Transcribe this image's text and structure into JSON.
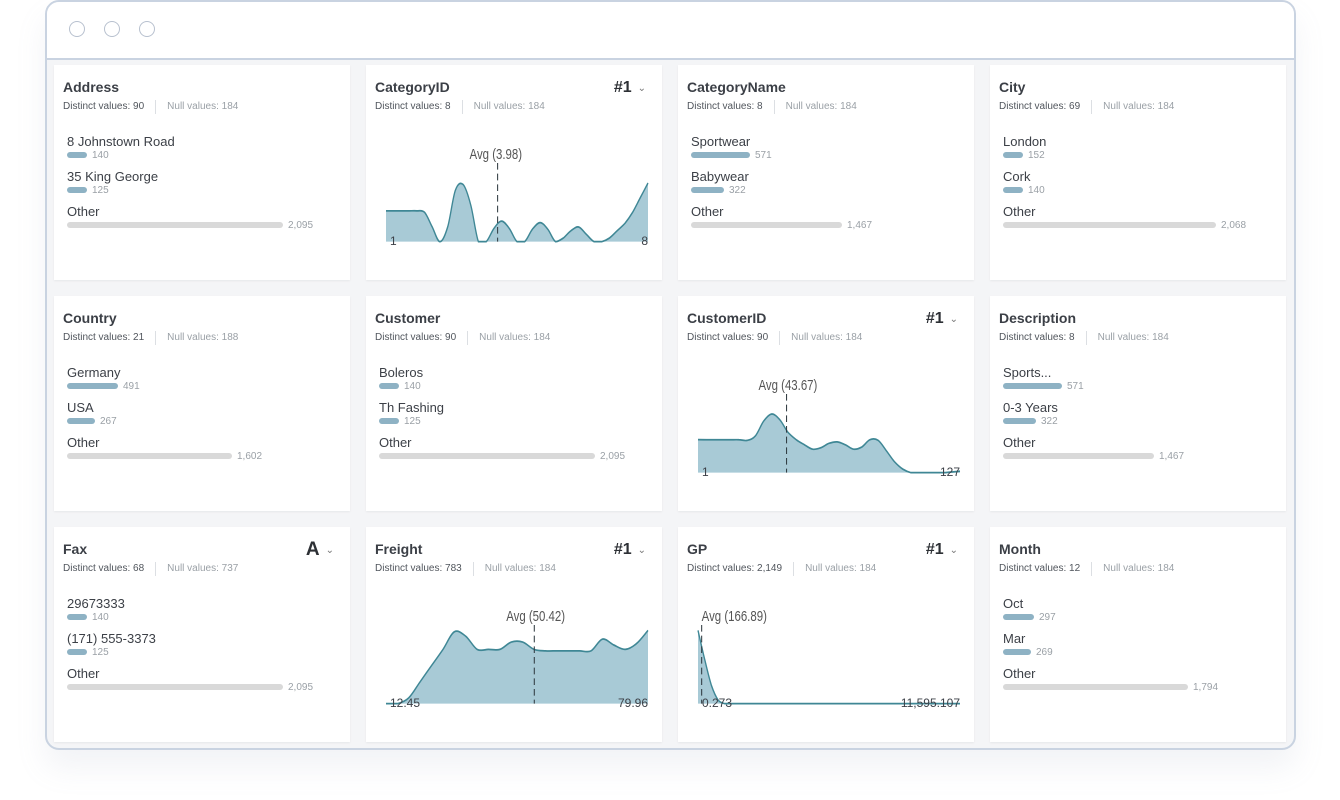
{
  "window": {
    "controls": [
      "close",
      "minimize",
      "maximize"
    ]
  },
  "labels": {
    "distinct_prefix": "Distinct values:",
    "null_prefix": "Null values:"
  },
  "cards": [
    {
      "title": "Address",
      "kind": "text",
      "distinct": "90",
      "nulls": "184",
      "values": [
        {
          "label": "8 Johnstown Road",
          "count": "140",
          "n": 140
        },
        {
          "label": "35 King George",
          "count": "125",
          "n": 125
        },
        {
          "label": "Other",
          "count": "2,095",
          "n": 2095,
          "other": true
        }
      ]
    },
    {
      "title": "CategoryID",
      "kind": "numeric",
      "type_label": "#1",
      "distinct": "8",
      "nulls": "184",
      "min": "1",
      "max": "8",
      "avg_label": "Avg (3.98)",
      "avg_frac": 0.426,
      "density": [
        0.42,
        0.42,
        0.42,
        0.42,
        0.42,
        0.4,
        0.2,
        0.0,
        0.2,
        0.7,
        0.78,
        0.5,
        0.0,
        0.0,
        0.18,
        0.28,
        0.18,
        0.0,
        0.0,
        0.17,
        0.26,
        0.17,
        0.0,
        0.05,
        0.15,
        0.2,
        0.1,
        0.0,
        0.0,
        0.05,
        0.15,
        0.25,
        0.4,
        0.6,
        0.8
      ]
    },
    {
      "title": "CategoryName",
      "kind": "text",
      "distinct": "8",
      "nulls": "184",
      "values": [
        {
          "label": "Sportwear",
          "count": "571",
          "n": 571
        },
        {
          "label": "Babywear",
          "count": "322",
          "n": 322
        },
        {
          "label": "Other",
          "count": "1,467",
          "n": 1467,
          "other": true
        }
      ]
    },
    {
      "title": "City",
      "kind": "text",
      "distinct": "69",
      "nulls": "184",
      "values": [
        {
          "label": "London",
          "count": "152",
          "n": 152
        },
        {
          "label": "Cork",
          "count": "140",
          "n": 140
        },
        {
          "label": "Other",
          "count": "2,068",
          "n": 2068,
          "other": true
        }
      ]
    },
    {
      "title": "Country",
      "kind": "text",
      "distinct": "21",
      "nulls": "188",
      "values": [
        {
          "label": "Germany",
          "count": "491",
          "n": 491
        },
        {
          "label": "USA",
          "count": "267",
          "n": 267
        },
        {
          "label": "Other",
          "count": "1,602",
          "n": 1602,
          "other": true
        }
      ]
    },
    {
      "title": "Customer",
      "kind": "text",
      "distinct": "90",
      "nulls": "184",
      "values": [
        {
          "label": "Boleros",
          "count": "140",
          "n": 140
        },
        {
          "label": "Th Fashing",
          "count": "125",
          "n": 125
        },
        {
          "label": "Other",
          "count": "2,095",
          "n": 2095,
          "other": true
        }
      ]
    },
    {
      "title": "CustomerID",
      "kind": "numeric",
      "type_label": "#1",
      "distinct": "90",
      "nulls": "184",
      "min": "1",
      "max": "127",
      "avg_label": "Avg (43.67)",
      "avg_frac": 0.338,
      "density": [
        0.45,
        0.45,
        0.45,
        0.45,
        0.45,
        0.45,
        0.44,
        0.5,
        0.7,
        0.8,
        0.72,
        0.55,
        0.45,
        0.38,
        0.32,
        0.34,
        0.4,
        0.42,
        0.38,
        0.32,
        0.35,
        0.45,
        0.44,
        0.3,
        0.15,
        0.05,
        0.0,
        0.0,
        0.0,
        0.0,
        0.0,
        0.01,
        0.02
      ]
    },
    {
      "title": "Description",
      "kind": "text",
      "distinct": "8",
      "nulls": "184",
      "values": [
        {
          "label": "Sports...",
          "count": "571",
          "n": 571
        },
        {
          "label": "0-3 Years",
          "count": "322",
          "n": 322
        },
        {
          "label": "Other",
          "count": "1,467",
          "n": 1467,
          "other": true
        }
      ]
    },
    {
      "title": "Fax",
      "kind": "text",
      "type_label": "A",
      "distinct": "68",
      "nulls": "737",
      "values": [
        {
          "label": "29673333",
          "count": "140",
          "n": 140
        },
        {
          "label": "(171) 555-3373",
          "count": "125",
          "n": 125
        },
        {
          "label": "Other",
          "count": "2,095",
          "n": 2095,
          "other": true
        }
      ]
    },
    {
      "title": "Freight",
      "kind": "numeric",
      "type_label": "#1",
      "distinct": "783",
      "nulls": "184",
      "min": "12.45",
      "max": "79.96",
      "avg_label": "Avg (50.42)",
      "avg_frac": 0.566,
      "density": [
        0.0,
        0.0,
        0.08,
        0.3,
        0.52,
        0.74,
        0.98,
        0.92,
        0.74,
        0.74,
        0.74,
        0.84,
        0.84,
        0.74,
        0.72,
        0.72,
        0.72,
        0.72,
        0.72,
        0.88,
        0.8,
        0.74,
        0.82,
        1.0
      ]
    },
    {
      "title": "GP",
      "kind": "numeric",
      "type_label": "#1",
      "distinct": "2,149",
      "nulls": "184",
      "min": "0.273",
      "max": "11,595.107",
      "avg_label": "Avg (166.89)",
      "avg_frac": 0.014,
      "density": [
        1.0,
        0.6,
        0.25,
        0.05,
        0.0,
        0.0,
        0.0,
        0.0,
        0.0,
        0.0,
        0.0,
        0.0,
        0.0,
        0.0,
        0.0,
        0.0,
        0.0,
        0.0,
        0.0,
        0.0,
        0.0,
        0.0,
        0.0,
        0.0,
        0.0,
        0.0,
        0.0,
        0.0,
        0.0,
        0.0,
        0.0,
        0.0,
        0.0,
        0.0,
        0.0,
        0.0,
        0.0,
        0.0,
        0.0,
        0.0
      ]
    },
    {
      "title": "Month",
      "kind": "text",
      "distinct": "12",
      "nulls": "184",
      "values": [
        {
          "label": "Oct",
          "count": "297",
          "n": 297
        },
        {
          "label": "Mar",
          "count": "269",
          "n": 269
        },
        {
          "label": "Other",
          "count": "1,794",
          "n": 1794,
          "other": true
        }
      ]
    }
  ],
  "colors": {
    "bar": "#8eb2c4",
    "bar_other": "#d9d9d9",
    "area_fill": "#a8cad6",
    "area_stroke": "#3f8795",
    "avg_line": "#2f3a40"
  }
}
